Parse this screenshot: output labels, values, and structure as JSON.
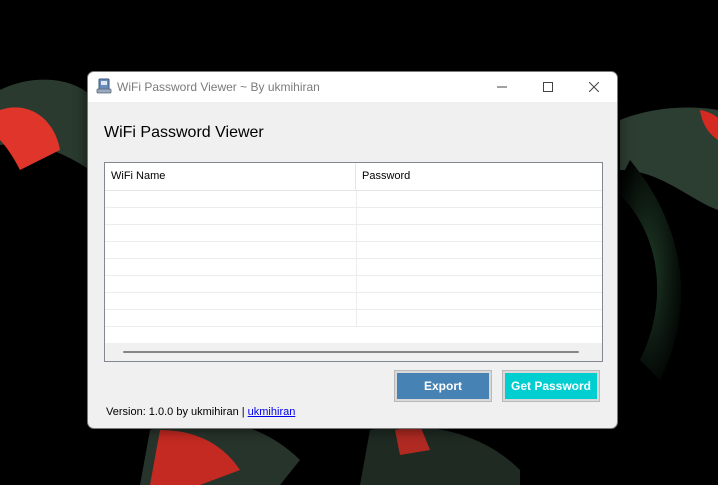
{
  "window": {
    "title": "WiFi Password Viewer ~ By ukmihiran",
    "heading": "WiFi Password Viewer"
  },
  "table": {
    "columns": [
      "WiFi Name",
      "Password"
    ],
    "rows": [
      [
        "",
        ""
      ],
      [
        "",
        ""
      ],
      [
        "",
        ""
      ],
      [
        "",
        ""
      ],
      [
        "",
        ""
      ],
      [
        "",
        ""
      ],
      [
        "",
        ""
      ],
      [
        "",
        ""
      ]
    ]
  },
  "buttons": {
    "export": "Export",
    "get_password": "Get Password"
  },
  "footer": {
    "version_text": "Version: 1.0.0 by ukmihiran | ",
    "link": "ukmihiran"
  },
  "colors": {
    "export": "#4682b4",
    "get_password": "#00ced1"
  }
}
